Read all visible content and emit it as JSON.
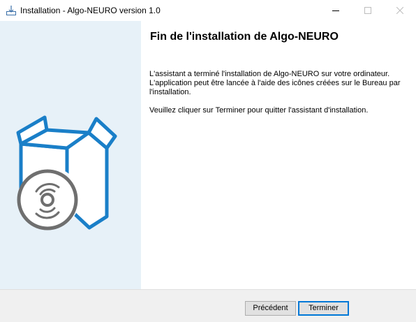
{
  "window": {
    "title": "Installation - Algo-NEURO version 1.0",
    "icon": "installer-icon"
  },
  "title_buttons": {
    "minimize": "minimize-icon",
    "maximize": "maximize-icon",
    "close": "close-icon"
  },
  "side_panel": {
    "illustration": "software-box-disc-icon"
  },
  "content": {
    "heading": "Fin de l'installation de Algo-NEURO",
    "paragraph1": "L'assistant a terminé l'installation de Algo-NEURO sur votre ordinateur. L'application peut être lancée à l'aide des icônes créées sur le Bureau par l'installation.",
    "paragraph2": "Veuillez cliquer sur Terminer pour quitter l'assistant d'installation."
  },
  "footer": {
    "back_label": "Précédent",
    "finish_label": "Terminer"
  },
  "colors": {
    "accent": "#0078d7",
    "box_blue": "#1a7fc8",
    "banner_bg": "#e7f1f8",
    "footer_bg": "#f0f0f0"
  }
}
